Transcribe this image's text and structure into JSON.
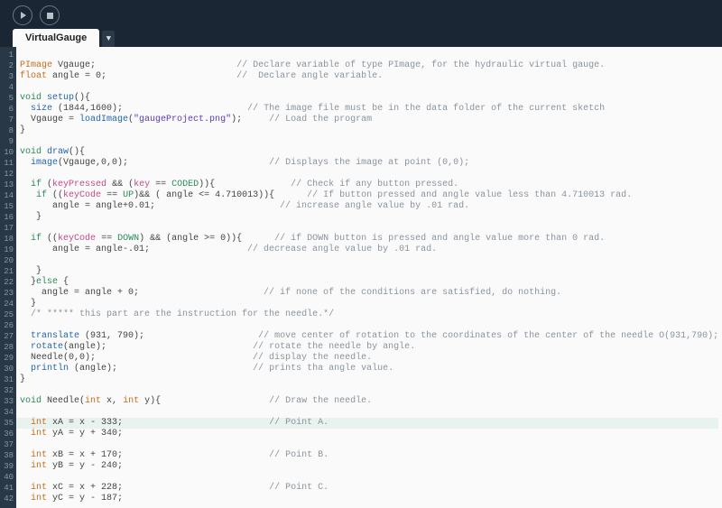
{
  "toolbar": {
    "run_label": "Run",
    "stop_label": "Stop"
  },
  "tabs": {
    "active": "VirtualGauge",
    "dropdown": "▼"
  },
  "gutter": {
    "start": 1,
    "end": 42
  },
  "code": {
    "lines": [
      {
        "seg": []
      },
      {
        "seg": [
          [
            "ty",
            "PImage"
          ],
          [
            "",
            " Vgauge;                          "
          ],
          [
            "cmt",
            "// Declare variable of type PImage, for the hydraulic virtual gauge."
          ]
        ]
      },
      {
        "seg": [
          [
            "ty",
            "float"
          ],
          [
            "",
            " angle = 0;                        "
          ],
          [
            "cmt",
            "//  Declare angle variable."
          ]
        ]
      },
      {
        "seg": []
      },
      {
        "seg": [
          [
            "kw1",
            "void"
          ],
          [
            "",
            " "
          ],
          [
            "fn",
            "setup"
          ],
          [
            "",
            "(){"
          ]
        ]
      },
      {
        "seg": [
          [
            "",
            "  "
          ],
          [
            "fn",
            "size"
          ],
          [
            "",
            " (1844,1600);                       "
          ],
          [
            "cmt",
            "// The image file must be in the data folder of the current sketch"
          ]
        ]
      },
      {
        "seg": [
          [
            "",
            "  Vgauge = "
          ],
          [
            "fn",
            "loadImage"
          ],
          [
            "",
            "("
          ],
          [
            "str",
            "\"gaugeProject.png\""
          ],
          [
            "",
            ");     "
          ],
          [
            "cmt",
            "// Load the program"
          ]
        ]
      },
      {
        "seg": [
          [
            "",
            "}"
          ]
        ]
      },
      {
        "seg": []
      },
      {
        "seg": [
          [
            "kw1",
            "void"
          ],
          [
            "",
            " "
          ],
          [
            "fn",
            "draw"
          ],
          [
            "",
            "(){"
          ]
        ]
      },
      {
        "seg": [
          [
            "",
            "  "
          ],
          [
            "fn",
            "image"
          ],
          [
            "",
            "(Vgauge,0,0);                          "
          ],
          [
            "cmt",
            "// Displays the image at point (0,0);"
          ]
        ]
      },
      {
        "seg": []
      },
      {
        "seg": [
          [
            "",
            "  "
          ],
          [
            "kw1",
            "if"
          ],
          [
            "",
            " ("
          ],
          [
            "kw2",
            "keyPressed"
          ],
          [
            "",
            " && ("
          ],
          [
            "kw2",
            "key"
          ],
          [
            "",
            " == "
          ],
          [
            "grn",
            "CODED"
          ],
          [
            "",
            ")){              "
          ],
          [
            "cmt",
            "// Check if any button pressed."
          ]
        ]
      },
      {
        "seg": [
          [
            "",
            "   "
          ],
          [
            "kw1",
            "if"
          ],
          [
            "",
            " (("
          ],
          [
            "kw2",
            "keyCode"
          ],
          [
            "",
            " == "
          ],
          [
            "grn",
            "UP"
          ],
          [
            "",
            ")&& ( angle <= 4.710013)){      "
          ],
          [
            "cmt",
            "// If button pressed and angle value less than 4.710013 rad."
          ]
        ]
      },
      {
        "seg": [
          [
            "",
            "      angle = angle+0.01;                       "
          ],
          [
            "cmt",
            "// increase angle value by .01 rad."
          ]
        ]
      },
      {
        "seg": [
          [
            "",
            "   }"
          ]
        ]
      },
      {
        "seg": []
      },
      {
        "seg": [
          [
            "",
            "  "
          ],
          [
            "kw1",
            "if"
          ],
          [
            "",
            " (("
          ],
          [
            "kw2",
            "keyCode"
          ],
          [
            "",
            " == "
          ],
          [
            "grn",
            "DOWN"
          ],
          [
            "",
            ") && (angle >= 0)){      "
          ],
          [
            "cmt",
            "// if DOWN button is pressed and angle value more than 0 rad."
          ]
        ]
      },
      {
        "seg": [
          [
            "",
            "      angle = angle-.01;                  "
          ],
          [
            "cmt",
            "// decrease angle value by .01 rad."
          ]
        ]
      },
      {
        "seg": []
      },
      {
        "seg": [
          [
            "",
            "   }"
          ]
        ]
      },
      {
        "seg": [
          [
            "",
            "  }"
          ],
          [
            "kw1",
            "else"
          ],
          [
            "",
            " {"
          ]
        ]
      },
      {
        "seg": [
          [
            "",
            "    angle = angle + 0;                       "
          ],
          [
            "cmt",
            "// if none of the conditions are satisfied, do nothing."
          ]
        ]
      },
      {
        "seg": [
          [
            "",
            "  }"
          ]
        ]
      },
      {
        "seg": [
          [
            "",
            "  "
          ],
          [
            "cmt",
            "/* ***** this part are the instruction for the needle.*/"
          ]
        ]
      },
      {
        "seg": []
      },
      {
        "seg": [
          [
            "",
            "  "
          ],
          [
            "fn",
            "translate"
          ],
          [
            "",
            " (931, 790);                     "
          ],
          [
            "cmt",
            "// move center of rotation to the coordinates of the center of the needle O(931,790);"
          ]
        ]
      },
      {
        "seg": [
          [
            "",
            "  "
          ],
          [
            "fn",
            "rotate"
          ],
          [
            "",
            "(angle);                           "
          ],
          [
            "cmt",
            "// rotate the needle by angle."
          ]
        ]
      },
      {
        "seg": [
          [
            "",
            "  Needle(0,0);                             "
          ],
          [
            "cmt",
            "// display the needle."
          ]
        ]
      },
      {
        "seg": [
          [
            "",
            "  "
          ],
          [
            "fn",
            "println"
          ],
          [
            "",
            " (angle);                         "
          ],
          [
            "cmt",
            "// prints tha angle value."
          ]
        ]
      },
      {
        "seg": [
          [
            "",
            "}"
          ]
        ]
      },
      {
        "seg": []
      },
      {
        "seg": [
          [
            "kw1",
            "void"
          ],
          [
            "",
            " Needle("
          ],
          [
            "ty",
            "int"
          ],
          [
            "",
            " x, "
          ],
          [
            "ty",
            "int"
          ],
          [
            "",
            " y){                    "
          ],
          [
            "cmt",
            "// Draw the needle."
          ]
        ]
      },
      {
        "seg": []
      },
      {
        "hl": true,
        "seg": [
          [
            "",
            "  "
          ],
          [
            "ty",
            "int"
          ],
          [
            "",
            " xA = x - 333;                           "
          ],
          [
            "cmt",
            "// Point A."
          ]
        ]
      },
      {
        "seg": [
          [
            "",
            "  "
          ],
          [
            "ty",
            "int"
          ],
          [
            "",
            " yA = y + 340;"
          ]
        ]
      },
      {
        "seg": []
      },
      {
        "seg": [
          [
            "",
            "  "
          ],
          [
            "ty",
            "int"
          ],
          [
            "",
            " xB = x + 170;                           "
          ],
          [
            "cmt",
            "// Point B."
          ]
        ]
      },
      {
        "seg": [
          [
            "",
            "  "
          ],
          [
            "ty",
            "int"
          ],
          [
            "",
            " yB = y - 240;"
          ]
        ]
      },
      {
        "seg": []
      },
      {
        "seg": [
          [
            "",
            "  "
          ],
          [
            "ty",
            "int"
          ],
          [
            "",
            " xC = x + 228;                           "
          ],
          [
            "cmt",
            "// Point C."
          ]
        ]
      },
      {
        "seg": [
          [
            "",
            "  "
          ],
          [
            "ty",
            "int"
          ],
          [
            "",
            " yC = y - 187;"
          ]
        ]
      }
    ]
  }
}
